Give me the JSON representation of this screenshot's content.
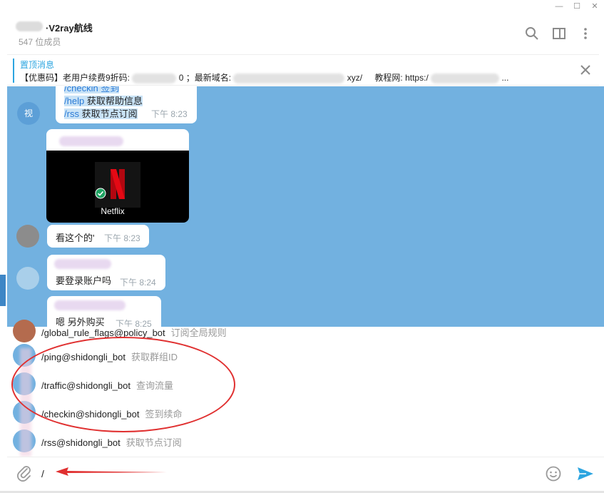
{
  "window": {
    "minimize": "—",
    "maximize": "☐",
    "close": "✕"
  },
  "header": {
    "title": "·V2ray航线",
    "members": "547 位成员"
  },
  "pinned": {
    "label": "置顶消息",
    "text_a": "【优惠码】老用户续费9折码:",
    "text_b": "0 ；最新域名:",
    "text_c": "xyz/",
    "text_d": "教程网: https:/",
    "ellipsis": "..."
  },
  "messages": {
    "cmd_checkin": "/checkin 签到",
    "help_cmd": "/help",
    "help_desc": " 获取帮助信息",
    "rss_cmd": "/rss",
    "rss_desc": " 获取节点订阅",
    "time1": "下午 8:23",
    "avatar_label": "视",
    "netflix_label": "Netflix",
    "msg2_text": "看这个的'",
    "msg2_time": "下午 8:23",
    "msg3_text": "要登录账户吗",
    "msg3_time": "下午 8:24",
    "msg4_text": "嗯 另外购买",
    "msg4_time": "下午 8:25"
  },
  "commands": [
    {
      "cmd": "/global_rule_flags@policy_bot",
      "desc": "订阅全局规则"
    },
    {
      "cmd": "/ping@shidongli_bot",
      "desc": "获取群组ID"
    },
    {
      "cmd": "/traffic@shidongli_bot",
      "desc": "查询流量"
    },
    {
      "cmd": "/checkin@shidongli_bot",
      "desc": "签到续命"
    },
    {
      "cmd": "/rss@shidongli_bot",
      "desc": "获取节点订阅"
    }
  ],
  "input": {
    "value": "/"
  },
  "colors": {
    "accent": "#2ca5e0",
    "selection": "#72b1e0",
    "annotation": "#e03030"
  }
}
